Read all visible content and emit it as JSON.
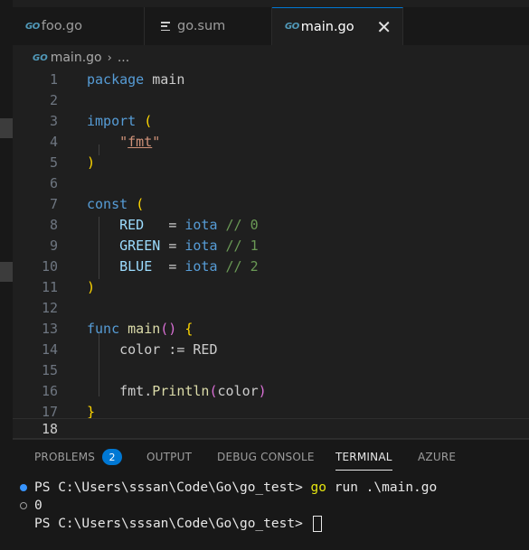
{
  "tabs": [
    {
      "icon": "go-icon",
      "label": "foo.go",
      "active": false
    },
    {
      "icon": "lines-icon",
      "label": "go.sum",
      "active": false
    },
    {
      "icon": "go-icon",
      "label": "main.go",
      "active": true,
      "close": "✕"
    }
  ],
  "go_logo_text": "GO",
  "breadcrumb": {
    "file": "main.go",
    "sep": "›",
    "more": "..."
  },
  "editor": {
    "current_line": 18,
    "line_numbers": [
      "1",
      "2",
      "3",
      "4",
      "5",
      "6",
      "7",
      "8",
      "9",
      "10",
      "11",
      "12",
      "13",
      "14",
      "15",
      "16",
      "17",
      "18"
    ],
    "code": {
      "l1": {
        "kw": "package",
        "rest": " main"
      },
      "l3": {
        "kw": "import",
        "brace": "("
      },
      "l4": {
        "indent": "    ",
        "q1": "\"",
        "str": "fmt",
        "q2": "\""
      },
      "l5": {
        "brace": ")"
      },
      "l7": {
        "kw": "const",
        "brace": "("
      },
      "l8": {
        "name": "    RED   ",
        "op": "= ",
        "val": "iota",
        "cmt": " // 0"
      },
      "l9": {
        "name": "    GREEN ",
        "op": "= ",
        "val": "iota",
        "cmt": " // 1"
      },
      "l10": {
        "name": "    BLUE  ",
        "op": "= ",
        "val": "iota",
        "cmt": " // 2"
      },
      "l11": {
        "brace": ")"
      },
      "l13": {
        "kw": "func",
        "fn": "main",
        "paren": "()",
        "brace": "{"
      },
      "l14": {
        "text": "    color := RED"
      },
      "l16": {
        "pkg": "    fmt.",
        "fn": "Println",
        "p1": "(",
        "arg": "color",
        "p2": ")"
      },
      "l17": {
        "brace": "}"
      }
    }
  },
  "panel": {
    "tabs": [
      {
        "label": "PROBLEMS",
        "badge": "2"
      },
      {
        "label": "OUTPUT"
      },
      {
        "label": "DEBUG CONSOLE"
      },
      {
        "label": "TERMINAL",
        "active": true
      },
      {
        "label": "AZURE"
      }
    ],
    "terminal": {
      "line1_prompt": "PS C:\\Users\\sssan\\Code\\Go\\go_test> ",
      "line1_cmd_go": "go",
      "line1_cmd_rest": " run .\\main.go",
      "line2_output": "0",
      "line3_prompt": "PS C:\\Users\\sssan\\Code\\Go\\go_test> "
    }
  },
  "colors": {
    "accent": "#0078d4",
    "keyword": "#569cd6",
    "string": "#ce9178",
    "comment": "#6a9955",
    "brace": "#ffd700"
  }
}
